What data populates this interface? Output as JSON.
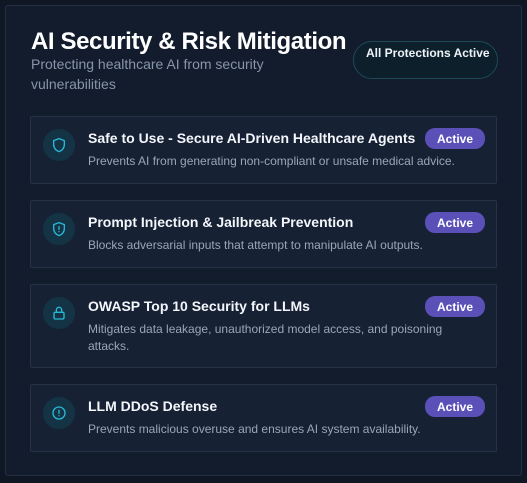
{
  "header": {
    "title": "AI Security & Risk Mitigation",
    "subtitle": "Protecting healthcare AI from security vulnerabilities",
    "status_pill": "All Protections Active"
  },
  "colors": {
    "background": "#131c2d",
    "card": "#172134",
    "badge": "#5a50b8",
    "icon_accent": "#2ab8d8"
  },
  "protections": [
    {
      "icon": "shield-icon",
      "title": "Safe to Use - Secure AI-Driven Healthcare Agents",
      "description": "Prevents AI from generating non-compliant or unsafe medical advice.",
      "status": "Active"
    },
    {
      "icon": "shield-alert-icon",
      "title": "Prompt Injection & Jailbreak Prevention",
      "description": "Blocks adversarial inputs that attempt to manipulate AI outputs.",
      "status": "Active"
    },
    {
      "icon": "lock-icon",
      "title": "OWASP Top 10 Security for LLMs",
      "description": "Mitigates data leakage, unauthorized model access, and poisoning attacks.",
      "status": "Active"
    },
    {
      "icon": "alert-circle-icon",
      "title": "LLM DDoS Defense",
      "description": "Prevents malicious overuse and ensures AI system availability.",
      "status": "Active"
    }
  ]
}
